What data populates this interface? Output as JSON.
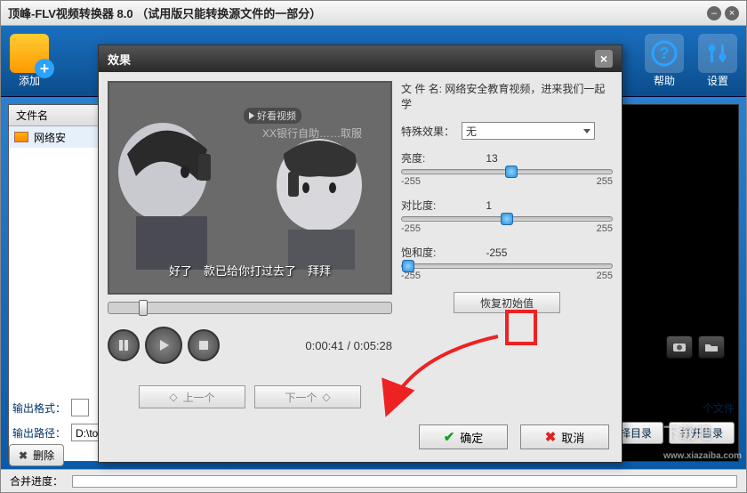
{
  "titlebar": {
    "text": "顶峰-FLV视频转换器 8.0 （试用版只能转换源文件的一部分）"
  },
  "toolbar": {
    "add": "添加",
    "help": "帮助",
    "settings": "设置"
  },
  "filelist": {
    "header": "文件名",
    "row": "网络安"
  },
  "bottom": {
    "delete": "删除"
  },
  "fields": {
    "fmt_label": "输出格式：",
    "path_label": "输出路径：",
    "path_value": "D:\\tools\\桌面\\",
    "side_text": "个文件",
    "sel_dir": "选择目录",
    "open_dir": "打开目录"
  },
  "status": {
    "label": "合并进度："
  },
  "dialog": {
    "title": "效果",
    "file_label": "文 件 名:",
    "file_name": "网络安全教育视频，进来我们一起学",
    "effect_label": "特殊效果：",
    "effect_value": "无",
    "brightness_label": "亮度:",
    "brightness_value": "13",
    "contrast_label": "对比度:",
    "contrast_value": "1",
    "saturation_label": "饱和度:",
    "saturation_value": "-255",
    "min": "-255",
    "max": "255",
    "restore": "恢复初始值",
    "prev": "上一个",
    "next": "下一个",
    "ok": "确定",
    "cancel": "取消",
    "time_cur": "0:00:41",
    "time_sep": "/",
    "time_tot": "0:05:28",
    "subtitle": "好了　款已给你打过去了　拜拜",
    "watermark": "好看视频",
    "banner": "XX银行自助……取服务……"
  },
  "download_mark": "下载吧"
}
